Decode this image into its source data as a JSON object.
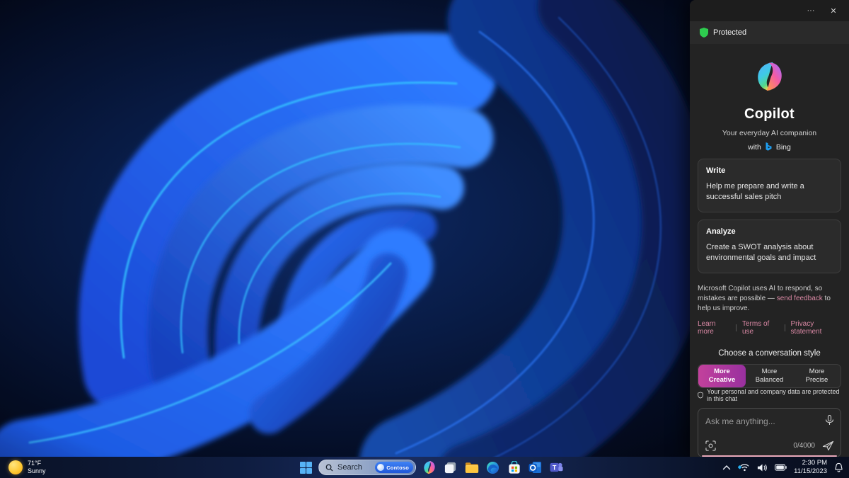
{
  "panel": {
    "titlebar": {
      "more": "···",
      "close": "✕"
    },
    "protected_label": "Protected",
    "hero": {
      "title": "Copilot",
      "subtitle": "Your everyday AI companion",
      "with_label": "with",
      "bing_label": "Bing"
    },
    "cards": [
      {
        "title": "Write",
        "body": "Help me prepare and write a successful sales pitch"
      },
      {
        "title": "Analyze",
        "body": "Create a SWOT analysis about environmental goals and impact"
      }
    ],
    "disclaimer": {
      "prefix": "Microsoft Copilot uses AI to respond, so mistakes are possible — ",
      "link": "send feedback",
      "suffix": " to help us improve."
    },
    "footer_links": [
      "Learn more",
      "Terms of use",
      "Privacy statement"
    ],
    "style_chooser": {
      "heading": "Choose a conversation style",
      "options": [
        {
          "line1": "More",
          "line2": "Creative",
          "selected": true
        },
        {
          "line1": "More",
          "line2": "Balanced",
          "selected": false
        },
        {
          "line1": "More",
          "line2": "Precise",
          "selected": false
        }
      ]
    },
    "privacy_note": "Your personal and company data are protected in this chat",
    "input": {
      "placeholder": "Ask me anything...",
      "counter": "0/4000"
    }
  },
  "taskbar": {
    "weather": {
      "temperature": "71°F",
      "condition": "Sunny"
    },
    "search_label": "Search",
    "contoso_label": "Contoso",
    "apps": [
      "Start",
      "Search",
      "Copilot",
      "Task View",
      "File Explorer",
      "Microsoft Edge",
      "Microsoft Store",
      "Outlook",
      "Microsoft Teams"
    ],
    "tray": {
      "time": "2:30 PM",
      "date": "11/15/2023"
    }
  },
  "colors": {
    "protected_green": "#2ecc4f",
    "link_pink": "#d988a4",
    "style_selected_start": "#c2419c",
    "style_selected_end": "#99309f",
    "input_underline_pink": "#e9a9ba",
    "contoso_blue": "#2e6ff0",
    "panel_bg": "#232323",
    "card_bg": "#2b2b2b"
  }
}
